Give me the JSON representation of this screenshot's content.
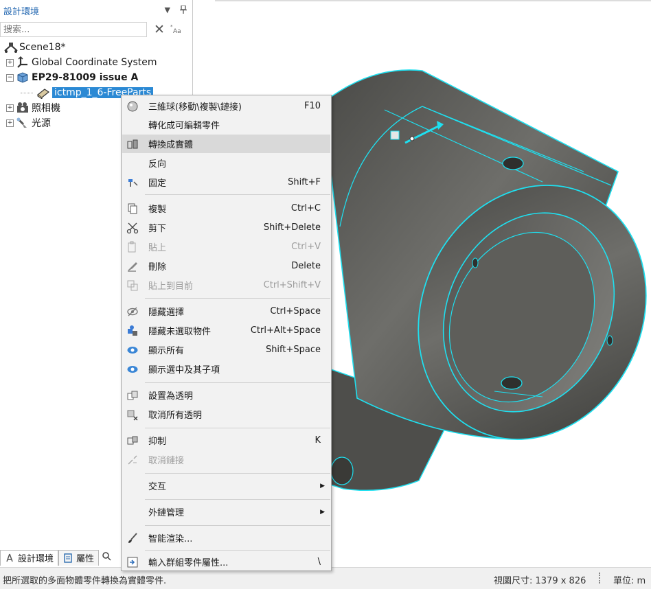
{
  "panel": {
    "title": "設計環境",
    "search_placeholder": "搜索...",
    "tree": [
      {
        "label": "Scene18*",
        "icon": "scene-icon"
      },
      {
        "label": "Global Coordinate System",
        "icon": "coordinate-system-icon"
      },
      {
        "label": "EP29-81009 issue A",
        "icon": "assembly-icon"
      },
      {
        "label": "ictmp_1_6-FreeParts",
        "icon": "part-icon"
      },
      {
        "label": "照相機",
        "icon": "camera-icon"
      },
      {
        "label": "光源",
        "icon": "light-icon"
      }
    ],
    "bottom_tabs": [
      {
        "label": "設計環境"
      },
      {
        "label": "屬性"
      }
    ]
  },
  "context_menu": {
    "items": [
      {
        "label": "三維球(移動\\複製\\鏈接)",
        "shortcut": "F10",
        "icon": "sphere-icon"
      },
      {
        "label": "轉化成可編輯零件",
        "shortcut": "",
        "icon": ""
      },
      {
        "label": "轉換成實體",
        "shortcut": "",
        "icon": "convert-solid-icon"
      },
      {
        "label": "反向",
        "shortcut": "",
        "icon": ""
      },
      {
        "label": "固定",
        "shortcut": "Shift+F",
        "icon": "pin-icon"
      },
      {
        "label": "複製",
        "shortcut": "Ctrl+C",
        "icon": "copy-icon"
      },
      {
        "label": "剪下",
        "shortcut": "Shift+Delete",
        "icon": "scissors-icon"
      },
      {
        "label": "貼上",
        "shortcut": "Ctrl+V",
        "icon": "paste-icon"
      },
      {
        "label": "刪除",
        "shortcut": "Delete",
        "icon": "eraser-icon"
      },
      {
        "label": "貼上到目前",
        "shortcut": "Ctrl+Shift+V",
        "icon": "paste-here-icon"
      },
      {
        "label": "隱藏選擇",
        "shortcut": "Ctrl+Space",
        "icon": "hide-eye-icon"
      },
      {
        "label": "隱藏未選取物件",
        "shortcut": "Ctrl+Alt+Space",
        "icon": "hide-unselected-icon"
      },
      {
        "label": "顯示所有",
        "shortcut": "Shift+Space",
        "icon": "show-eye-icon"
      },
      {
        "label": "顯示選中及其子項",
        "shortcut": "",
        "icon": "show-eye-icon"
      },
      {
        "label": "設置為透明",
        "shortcut": "",
        "icon": "transparent-icon"
      },
      {
        "label": "取消所有透明",
        "shortcut": "",
        "icon": "cancel-transparent-icon"
      },
      {
        "label": "抑制",
        "shortcut": "K",
        "icon": "suppress-icon"
      },
      {
        "label": "取消鏈接",
        "shortcut": "",
        "icon": "unlink-icon"
      },
      {
        "label": "交互",
        "shortcut": "",
        "icon": ""
      },
      {
        "label": "外鏈管理",
        "shortcut": "",
        "icon": ""
      },
      {
        "label": "智能渲染...",
        "shortcut": "",
        "icon": "brush-icon"
      },
      {
        "label": "輸入群組零件屬性...",
        "shortcut": "\\",
        "icon": "import-props-icon"
      }
    ]
  },
  "status": {
    "message": "把所選取的多面物體零件轉換為實體零件.",
    "view_size": "視圖尺寸: 1379 x  826",
    "unit": "單位:  m"
  },
  "colors": {
    "selection": "#2b89d4",
    "edge_highlight": "#1ee0f0",
    "body": "#5b5b58",
    "panel_title": "#2166b0"
  }
}
